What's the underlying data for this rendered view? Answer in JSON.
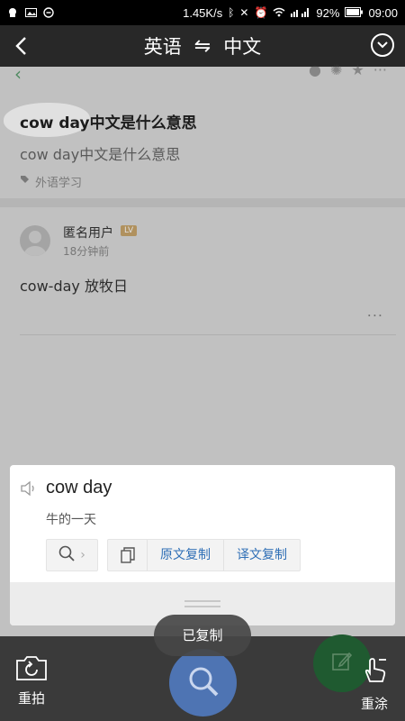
{
  "status_bar": {
    "speed": "1.45K/s",
    "battery": "92%",
    "time": "09:00"
  },
  "top_bar": {
    "source_lang": "英语",
    "swap_symbol": "⇋",
    "target_lang": "中文"
  },
  "underlying_page": {
    "question_title": "cow day中文是什么意思",
    "question_subtitle": "cow day中文是什么意思",
    "tag": "外语学习",
    "user_name": "匿名用户",
    "user_level": "LV",
    "user_time": "18分钟前",
    "answer": "cow-day 放牧日",
    "more": "..."
  },
  "result_card": {
    "source_text": "cow day",
    "translation": "牛的一天",
    "copy_source_label": "原文复制",
    "copy_translation_label": "译文复制"
  },
  "toast": {
    "text": "已复制"
  },
  "bottom_bar": {
    "retake_label": "重拍",
    "redo_label": "重涂"
  },
  "colors": {
    "accent_blue": "#2f6fb6",
    "capture_button": "#4e74b3",
    "green_button": "#1f5a30"
  }
}
